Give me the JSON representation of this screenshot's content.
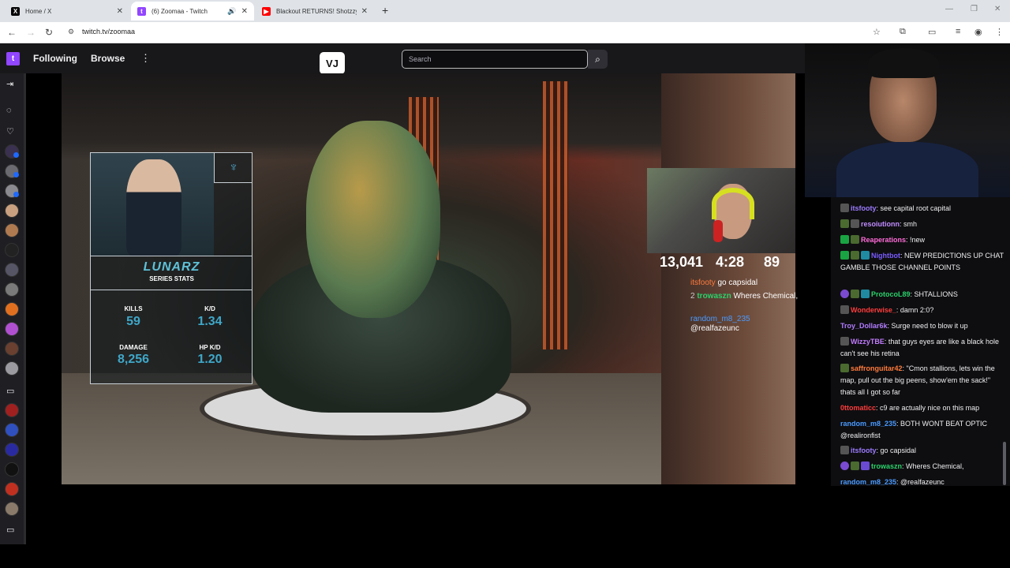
{
  "browser": {
    "tabs": [
      {
        "title": "Home / X",
        "favicon": "x-icon"
      },
      {
        "title": "(6) Zoomaa - Twitch",
        "favicon": "twitch-icon",
        "active": true
      },
      {
        "title": "Blackout RETURNS! Shotzzy's A",
        "favicon": "youtube-icon"
      }
    ],
    "url": "twitch.tv/zoomaa"
  },
  "twitch": {
    "nav": {
      "following": "Following",
      "browse": "Browse",
      "logo_text": "VJ"
    },
    "search_placeholder": "Search"
  },
  "video_overlay": {
    "player_name": "LUNARZ",
    "subtitle": "SERIES STATS",
    "stats": [
      {
        "label": "KILLS",
        "value": "59"
      },
      {
        "label": "K/D",
        "value": "1.34"
      },
      {
        "label": "DAMAGE",
        "value": "8,256"
      },
      {
        "label": "HP K/D",
        "value": "1.20"
      }
    ],
    "counters": {
      "viewers": "13,041",
      "time": "4:28",
      "score": "89"
    },
    "overlay_chat": [
      {
        "user": "itsfooty",
        "text": " go capsidal"
      },
      {
        "badge": "2",
        "user": "trowaszn",
        "text": " Wheres Chemical,"
      },
      {
        "user": "random_m8_235",
        "text": ""
      },
      {
        "user": "",
        "text": "@realfazeunc"
      }
    ]
  },
  "chat": {
    "messages": [
      {
        "user": "itsfooty",
        "color": "#9c7bff",
        "text": ": see capital root capital"
      },
      {
        "user": "resoiutionn",
        "color": "#c08bff",
        "text": ": smh"
      },
      {
        "user": "Reaperations",
        "color": "#ff6bd8",
        "text": ": !new"
      },
      {
        "user": "Nightbot",
        "color": "#7a5cff",
        "text": ": NEW PREDICTIONS UP CHAT GAMBLE THOSE CHANNEL POINTS"
      },
      {
        "user": "ProtocoL89",
        "color": "#2bd16b",
        "text": ": SHTALLIONS"
      },
      {
        "user": "Wonderwise_",
        "color": "#ff3c3c",
        "text": ": damn 2:0?"
      },
      {
        "user": "Troy_Dollar6k",
        "color": "#b27cff",
        "text": ": Surge need to blow it up"
      },
      {
        "user": "WizzyTBE",
        "color": "#c27cff",
        "text": ": that guys eyes are like a black hole can't see his retina"
      },
      {
        "user": "saffronguitar42",
        "color": "#ff7a3c",
        "text": ": \"Cmon stallions, lets win the map, pull out the big peens, show'em the sack!\" thats all I got so far"
      },
      {
        "user": "0ttomaticc",
        "color": "#ff3c3c",
        "text": ": c9 are actually nice on this map"
      },
      {
        "user": "random_m8_235",
        "color": "#4a9aff",
        "text": ": BOTH WONT BEAT OPTIC @realironfist"
      },
      {
        "user": "itsfooty",
        "color": "#9c7bff",
        "text": ": go capsidal"
      },
      {
        "user": "trowaszn",
        "color": "#2bd16b",
        "text": ": Wheres Chemical,"
      },
      {
        "user": "random_m8_235",
        "color": "#4a9aff",
        "text": ": @realfazeunc"
      }
    ]
  }
}
